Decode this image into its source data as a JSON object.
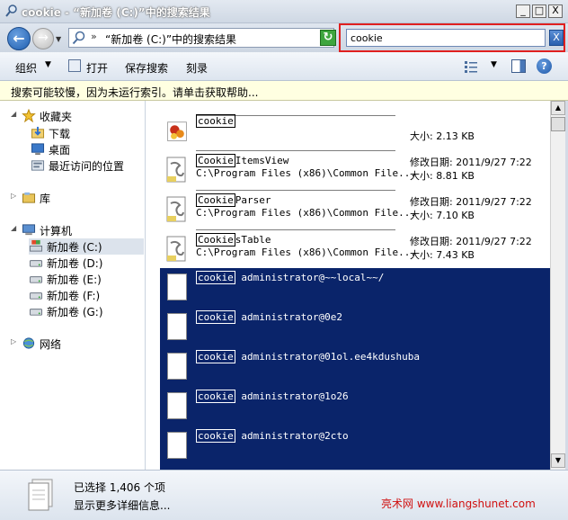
{
  "window": {
    "title": "cookie - “新加卷 (C:)”中的搜索结果",
    "min_glyph": "_",
    "max_glyph": "□",
    "close_glyph": "X"
  },
  "address": {
    "chevron": "»",
    "path": "“新加卷 (C:)”中的搜索结果",
    "dropdown_glyph": "▼",
    "search_value": "cookie",
    "search_clear_glyph": "X",
    "back_glyph": "←",
    "forward_glyph": "→",
    "refresh_glyph": "↻"
  },
  "toolbar": {
    "organize": "组织",
    "open": "打开",
    "save_search": "保存搜索",
    "burn": "刻录",
    "dropdown_glyph": "▼",
    "help_glyph": "?"
  },
  "infobar": {
    "text": "搜索可能较慢，因为未运行索引。请单击获取帮助..."
  },
  "nav": {
    "favorites": "收藏夹",
    "downloads": "下载",
    "desktop": "桌面",
    "recent": "最近访问的位置",
    "library": "库",
    "computer": "计算机",
    "drives": [
      {
        "label": "新加卷 (C:)"
      },
      {
        "label": "新加卷 (D:)"
      },
      {
        "label": "新加卷 (E:)"
      },
      {
        "label": "新加卷 (F:)"
      },
      {
        "label": "新加卷 (G:)"
      }
    ],
    "network": "网络"
  },
  "results": [
    {
      "hl": "cookie",
      "rest": "",
      "path": "",
      "date": "",
      "size": ""
    },
    {
      "hl": "",
      "rest": "",
      "path": "",
      "date": "",
      "size": "大小: 2.13 KB"
    },
    {
      "hl": "Cookie",
      "rest": "ItemsView",
      "path": "C:\\Program Files (x86)\\Common File...",
      "date": "修改日期: 2011/9/27 7:22",
      "size": "大小: 8.81 KB"
    },
    {
      "hl": "Cookie",
      "rest": "Parser",
      "path": "C:\\Program Files (x86)\\Common File...",
      "date": "修改日期: 2011/9/27 7:22",
      "size": "大小: 7.10 KB"
    },
    {
      "hl": "Cookie",
      "rest": "sTable",
      "path": "C:\\Program Files (x86)\\Common File...",
      "date": "修改日期: 2011/9/27 7:22",
      "size": "大小: 7.43 KB"
    }
  ],
  "selected_results": [
    {
      "hl": "cookie",
      "rest": " administrator@~~local~~/"
    },
    {
      "hl": "cookie",
      "rest": " administrator@0e2"
    },
    {
      "hl": "cookie",
      "rest": " administrator@01ol.ee4kdushuba"
    },
    {
      "hl": "cookie",
      "rest": " administrator@1o26"
    },
    {
      "hl": "cookie",
      "rest": " administrator@2cto"
    }
  ],
  "details": {
    "count": "已选择 1,406 个项",
    "more": "显示更多详细信息..."
  },
  "watermark": "亮术网 www.liangshunet.com",
  "colors": {
    "selection": "#0a246a",
    "search_highlight_border": "#e02020",
    "watermark": "#d01010"
  }
}
